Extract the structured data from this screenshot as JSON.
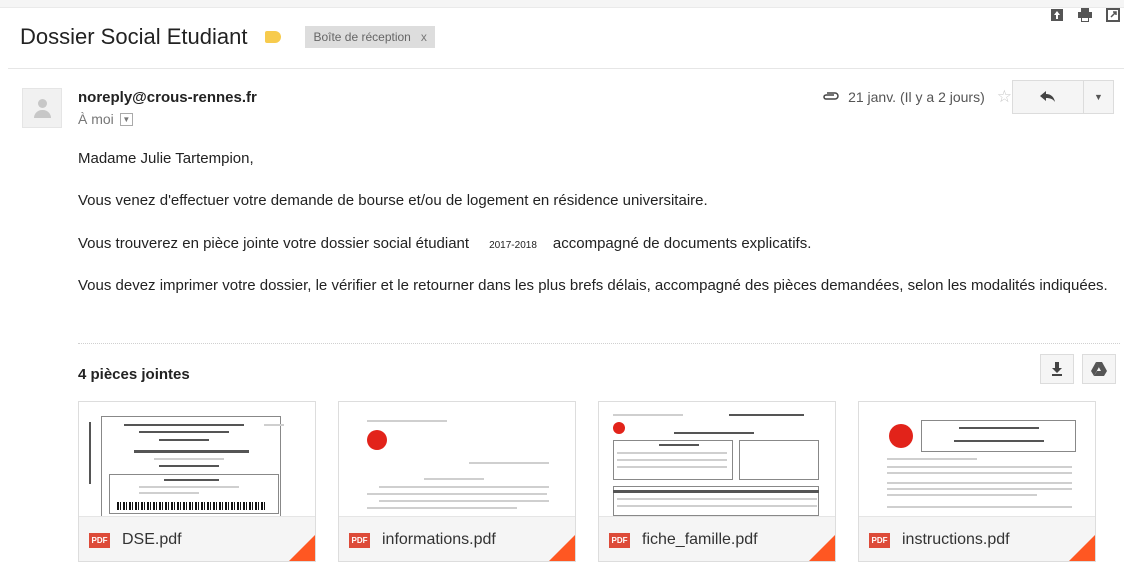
{
  "header": {
    "subject": "Dossier Social Etudiant",
    "label_color": "#f7cb4d",
    "inbox_chip": "Boîte de réception",
    "inbox_chip_close": "x",
    "icons": [
      "archive-icon",
      "print-icon",
      "new-window-icon"
    ]
  },
  "message": {
    "sender": "noreply@crous-rennes.fr",
    "recipient": "À moi",
    "date": "21 janv. (Il y a 2 jours)",
    "reply_icon": "reply-icon",
    "more_icon": "chevron-down-icon"
  },
  "body": {
    "greeting": "Madame Julie   Tartempion,",
    "paragraph1": "Vous venez d'effectuer votre demande de bourse et/ou de logement en résidence universitaire.",
    "paragraph2_start": "Vous trouverez en pièce jointe votre dossier social étudiant",
    "paragraph2_year": "2017-2018",
    "paragraph2_end": "accompagné de documents explicatifs.",
    "paragraph3": "Vous devez imprimer votre dossier, le vérifier et le retourner dans les plus brefs délais, accompagné des pièces demandées, selon les modalités indiquées."
  },
  "attachments": {
    "title": "4 pièces jointes",
    "actions": [
      "download-all-icon",
      "drive-icon"
    ],
    "pdf_label": "PDF",
    "fold_color": "#ff5722",
    "files": [
      {
        "name": "DSE.pdf"
      },
      {
        "name": "informations.pdf"
      },
      {
        "name": "fiche_famille.pdf"
      },
      {
        "name": "instructions.pdf"
      }
    ]
  }
}
